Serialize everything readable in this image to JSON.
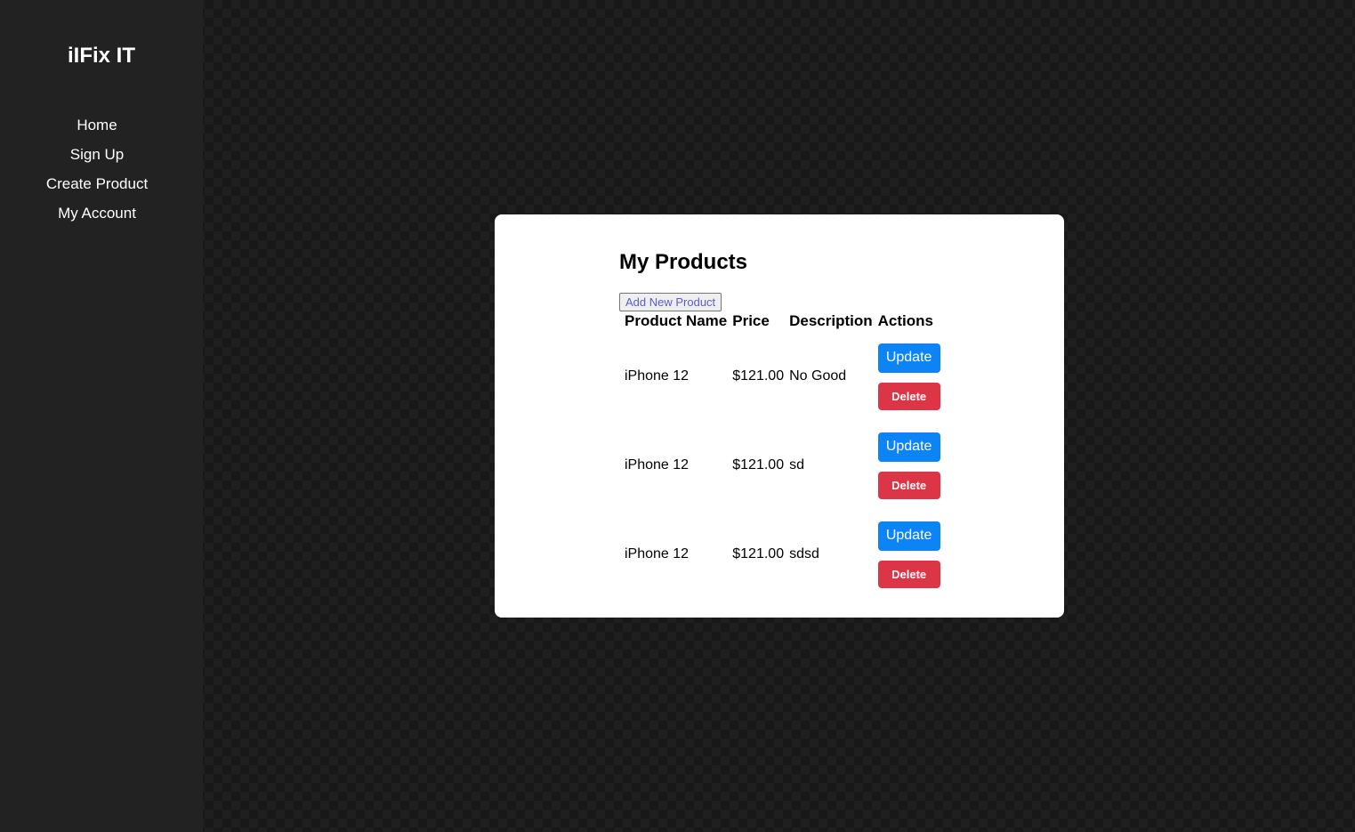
{
  "sidebar": {
    "brand": "iIFix IT",
    "items": [
      {
        "label": "Home"
      },
      {
        "label": "Sign Up"
      },
      {
        "label": "Create Product"
      },
      {
        "label": "My Account"
      }
    ]
  },
  "main": {
    "title": "My Products",
    "add_button_label": "Add New Product",
    "columns": [
      "Product Name",
      "Price",
      "Description",
      "Actions"
    ],
    "rows": [
      {
        "name": "iPhone 12",
        "price": "$121.00",
        "description": "No Good",
        "update_label": "Update",
        "delete_label": "Delete"
      },
      {
        "name": "iPhone 12",
        "price": "$121.00",
        "description": "sd",
        "update_label": "Update",
        "delete_label": "Delete"
      },
      {
        "name": "iPhone 12",
        "price": "$121.00",
        "description": "sdsd",
        "update_label": "Update",
        "delete_label": "Delete"
      }
    ]
  },
  "colors": {
    "update_button": "#0d84f5",
    "delete_button": "#dc3545",
    "sidebar_bg": "#222222",
    "card_bg": "#ffffff"
  }
}
